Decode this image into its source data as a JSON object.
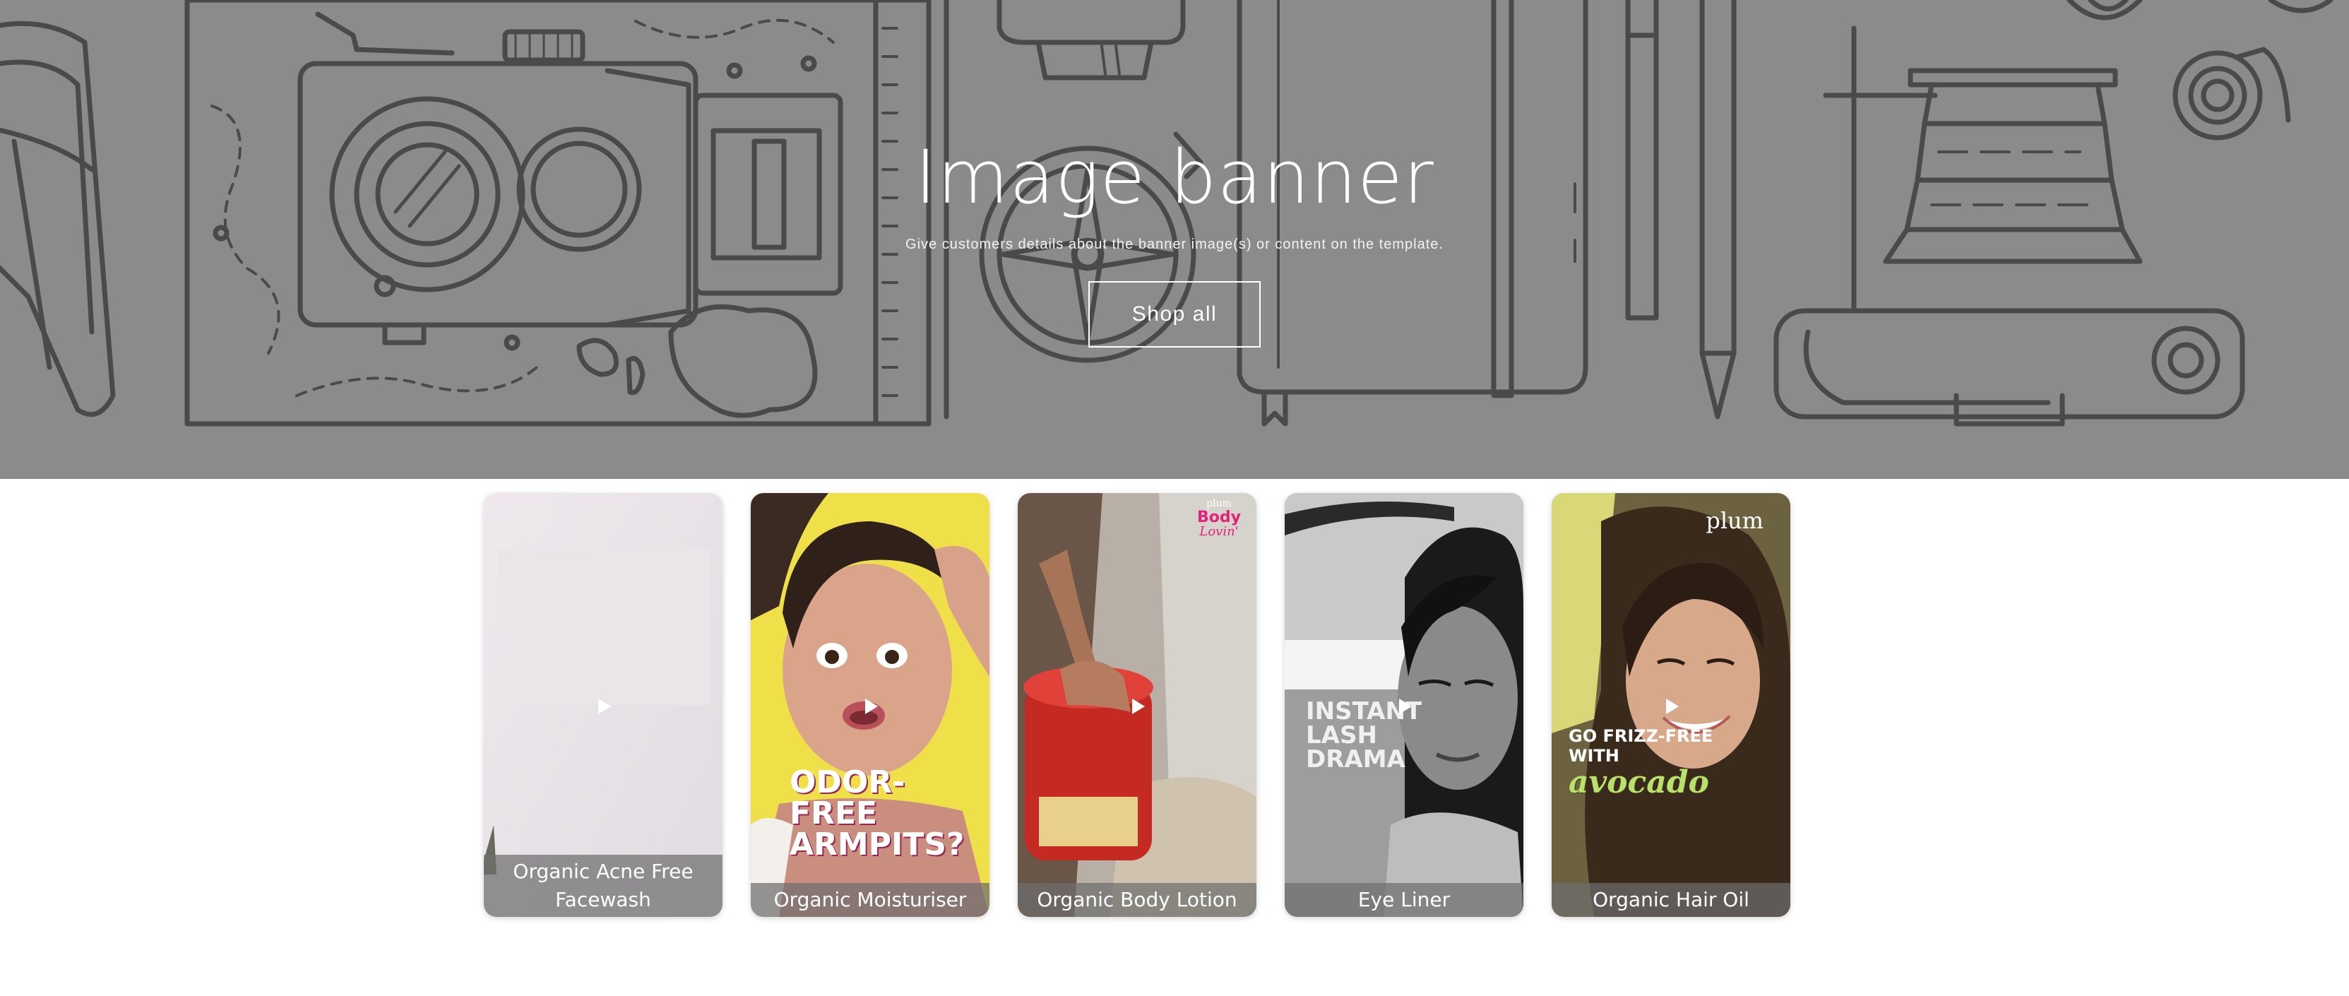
{
  "banner": {
    "title": "Image banner",
    "subtitle": "Give customers details about the banner image(s) or content on the template.",
    "button_label": "Shop all",
    "background_color": "#8b8b8b",
    "line_art_color": "#4a4a4a"
  },
  "videos": [
    {
      "caption": "Organic Acne Free Facewash",
      "thumbnail": "blank pale frame"
    },
    {
      "caption": "Organic Moisturiser",
      "thumbnail": "woman with surprised face on yellow background",
      "overlay_text": [
        "ODOR-FREE",
        "ARMPITS?"
      ]
    },
    {
      "caption": "Organic Body Lotion",
      "thumbnail": "hand scooping red body lotion jar",
      "brand_text": [
        "plum",
        "Body",
        "Lovin'"
      ]
    },
    {
      "caption": "Eye Liner",
      "thumbnail": "black and white portrait of woman",
      "overlay_text": [
        "INSTANT",
        "LASH",
        "DRAMA"
      ]
    },
    {
      "caption": "Organic Hair Oil",
      "thumbnail": "smiling woman with long hair",
      "brand_text": [
        "plum"
      ],
      "overlay_text": [
        "GO FRIZZ-FREE",
        "WITH",
        "avocado"
      ]
    }
  ],
  "icons": {
    "play": "play-icon"
  },
  "colors": {
    "accent_pink": "#e0247a",
    "accent_green": "#b9e06a",
    "caption_bg": "#6e6e6e"
  }
}
